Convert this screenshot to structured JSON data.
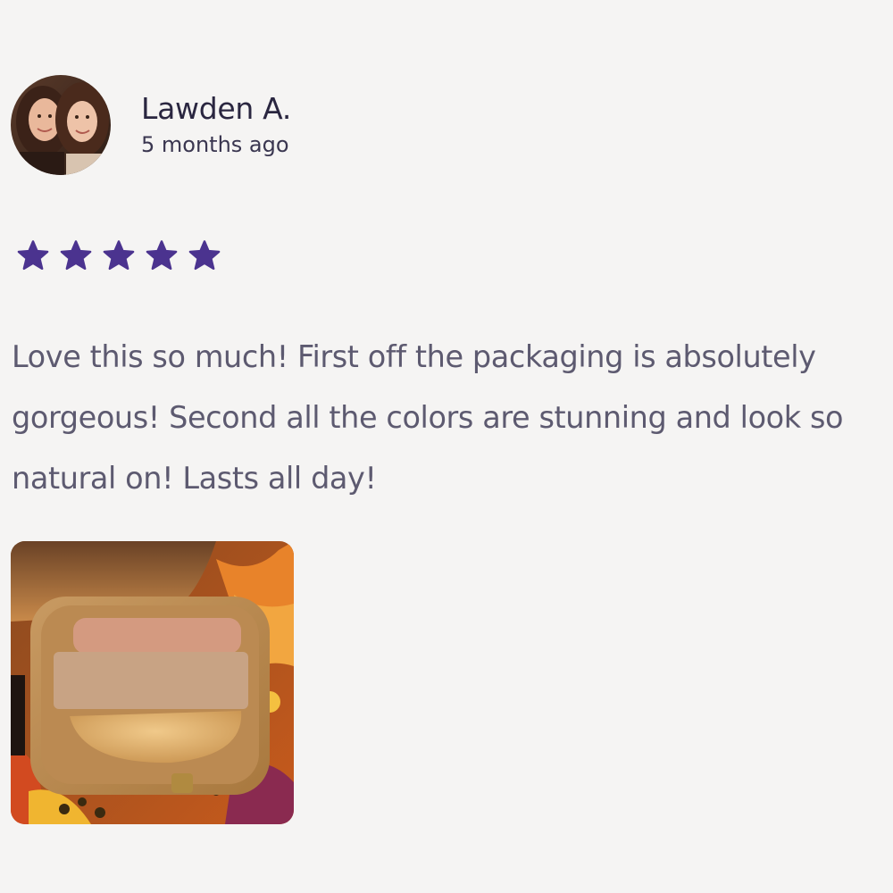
{
  "reviewer": {
    "name": "Lawden A.",
    "time": "5 months ago"
  },
  "rating": {
    "stars": 5,
    "max": 5,
    "color": "#4b338f"
  },
  "review": {
    "text": "Love this so much! First off the packaging is absolutely gorgeous! Second all the colors are stunning and look so natural on! Lasts all day!"
  },
  "icons": {
    "star": "star-icon"
  }
}
